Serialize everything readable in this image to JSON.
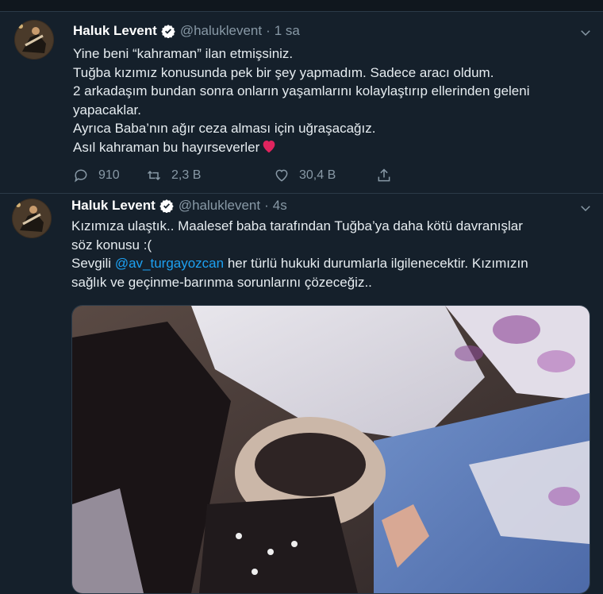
{
  "tweets": [
    {
      "name": "Haluk Levent",
      "handle": "@haluklevent",
      "separator": "·",
      "time": "1 sa",
      "lines": [
        "Yine beni “kahraman” ilan etmişsiniz.",
        "Tuğba kızımız konusunda pek bir şey yapmadım. Sadece aracı oldum.",
        "2 arkadaşım bundan sonra onların yaşamlarını kolaylaştırıp ellerinden geleni",
        "yapacaklar.",
        "Ayrıca Baba’nın ağır ceza alması için uğraşacağız.",
        "Asıl kahraman bu hayırseverler"
      ],
      "reply_count": "910",
      "retweet_count": "2,3 B",
      "like_count": "30,4 B"
    },
    {
      "name": "Haluk Levent",
      "handle": "@haluklevent",
      "separator": "·",
      "time": "4s",
      "line1": "Kızımıza ulaştık.. Maalesef baba tarafından Tuğba’ya   daha kötü davranışlar",
      "line2": "söz konusu :(",
      "line3_prefix": "Sevgili ",
      "mention": "@av_turgayozcan",
      "line3_suffix": " her türlü hukuki durumlarla ilgilenecektir. Kızımızın",
      "line4": "sağlık ve geçinme-barınma sorunlarını çözeceğiz.."
    }
  ],
  "colors": {
    "background": "#15202b",
    "text": "#e6ecf0",
    "secondary": "#8899a6",
    "accent": "#1da1f2",
    "heart": "#e0245e"
  },
  "icons": [
    "verified-badge-icon",
    "chevron-down-icon",
    "reply-icon",
    "retweet-icon",
    "like-icon",
    "share-icon",
    "heart-emoji"
  ]
}
